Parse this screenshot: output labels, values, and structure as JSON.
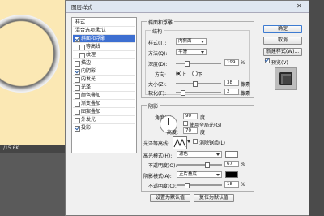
{
  "dialog_title": "图层样式",
  "close_glyph": "✕",
  "status": {
    "zoom": "/15.6K"
  },
  "style_list": {
    "header": "样式",
    "blend": "混合选项:默认",
    "items": [
      {
        "label": "斜面和浮雕",
        "checked": true
      },
      {
        "label": "等高线",
        "checked": false
      },
      {
        "label": "纹理",
        "checked": false
      },
      {
        "label": "描边",
        "checked": false
      },
      {
        "label": "内阴影",
        "checked": true
      },
      {
        "label": "内发光",
        "checked": false
      },
      {
        "label": "光泽",
        "checked": false
      },
      {
        "label": "颜色叠加",
        "checked": false
      },
      {
        "label": "渐变叠加",
        "checked": false
      },
      {
        "label": "图案叠加",
        "checked": false
      },
      {
        "label": "外发光",
        "checked": false
      },
      {
        "label": "投影",
        "checked": true
      }
    ]
  },
  "bevel": {
    "section_title": "斜面和浮雕",
    "structure_title": "结构",
    "style_label": "样式(T):",
    "style_value": "内斜面",
    "method_label": "方法(Q):",
    "method_value": "平滑",
    "depth_label": "深度(D):",
    "depth_value": "199",
    "depth_unit": "%",
    "depth_fraction": 0.2,
    "direction_label": "方向:",
    "up": "上",
    "down": "下",
    "size_label": "大小(Z):",
    "size_value": "38",
    "size_unit": "像素",
    "size_fraction": 0.4,
    "soften_label": "软化(F):",
    "soften_value": "2",
    "soften_unit": "像素",
    "soften_fraction": 0.1
  },
  "shading": {
    "title": "阴影",
    "angle_label": "角度(N):",
    "angle_value": "90",
    "angle_unit": "度",
    "global_light": "使用全局光(G)",
    "altitude_label": "高度:",
    "altitude_value": "70",
    "altitude_unit": "度",
    "gloss_label": "光泽等高线:",
    "antialias": "消除锯齿(L)",
    "highlight_label": "高光模式(H):",
    "highlight_mode": "滤色",
    "highlight_opacity_label": "不透明度(O):",
    "highlight_opacity": "67",
    "highlight_opacity_fraction": 0.67,
    "shadow_label": "阴影模式(A):",
    "shadow_mode": "正片叠底",
    "shadow_opacity_label": "不透明度(C):",
    "shadow_opacity": "18",
    "shadow_opacity_fraction": 0.18,
    "percent": "%",
    "highlight_color": "#ffffff",
    "shadow_color": "#000000"
  },
  "buttons": {
    "ok": "确定",
    "cancel": "取消",
    "new_style": "新建样式(W)...",
    "preview": "预览(V)",
    "set_default": "设置为默认值",
    "reset_default": "复位为默认值"
  }
}
